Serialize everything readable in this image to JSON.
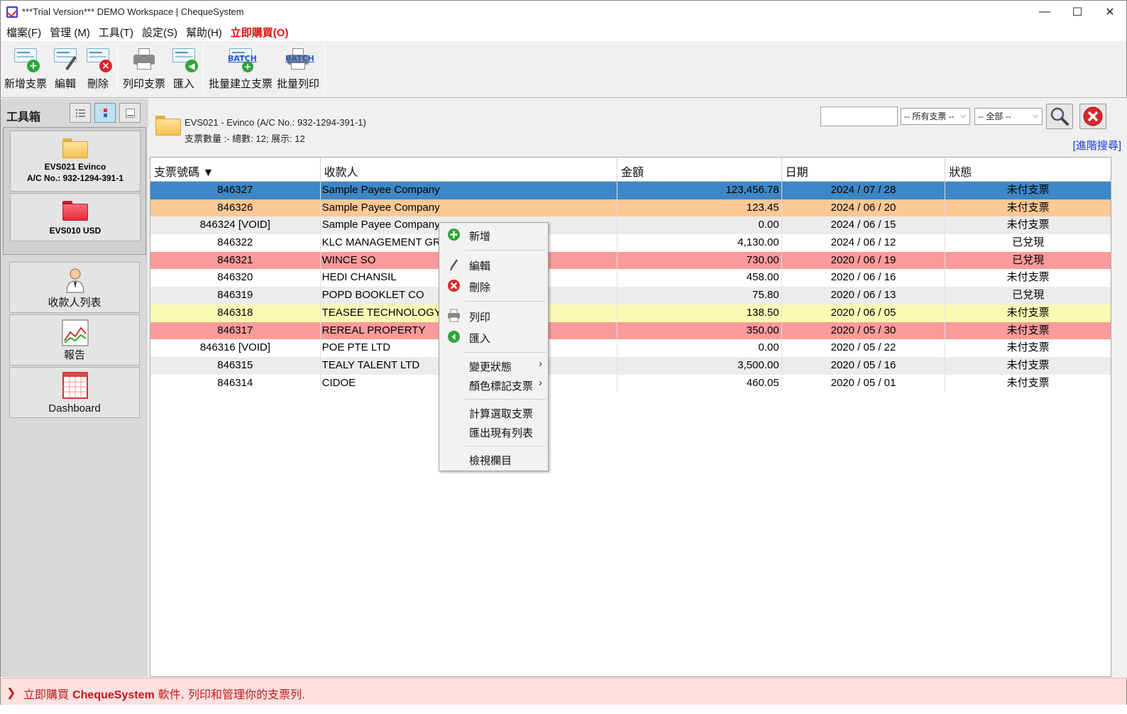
{
  "window": {
    "title": "***Trial Version*** DEMO Workspace | ChequeSystem",
    "minimize": "—",
    "maximize": "☐",
    "close": "✕"
  },
  "menu": [
    "檔案(F)",
    "管理 (M)",
    "工具(T)",
    "設定(S)",
    "幫助(H)",
    "立即購買(O)"
  ],
  "toolbar": {
    "new_cheque": "新增支票",
    "edit": "編輯",
    "delete": "刪除",
    "print_cheque": "列印支票",
    "import": "匯入",
    "batch_create": "批量建立支票",
    "batch_print": "批量列印",
    "batch_badge": "BATCH"
  },
  "sidebar": {
    "title": "工具箱",
    "accounts": [
      {
        "name": "EVS021 Evinco",
        "acno": "A/C No.: 932-1294-391-1"
      },
      {
        "name": "EVS010 USD",
        "acno": ""
      }
    ],
    "nav": [
      "收款人列表",
      "報告",
      "Dashboard"
    ]
  },
  "account_header": {
    "line1": "EVS021 - Evinco (A/C No.: 932-1294-391-1)",
    "line2": "支票數量 :- 總數: 12; 展示: 12"
  },
  "filters": {
    "search_value": "",
    "cheque_filter": "-- 所有支票 --",
    "status_filter": "-- 全部 --",
    "advanced_search": "[進階搜尋]"
  },
  "table": {
    "columns": [
      "支票號碼 ▼",
      "收款人",
      "金額",
      "日期",
      "狀態"
    ],
    "rows": [
      {
        "no": "846327",
        "payee": "Sample Payee Company",
        "amount": "123,456.78",
        "date": "2024 / 07 / 28",
        "status": "未付支票",
        "bg": "#3d87c6"
      },
      {
        "no": "846326",
        "payee": "Sample Payee Company",
        "amount": "123.45",
        "date": "2024 / 06 / 20",
        "status": "未付支票",
        "bg": "#fcc896"
      },
      {
        "no": "846324 [VOID]",
        "payee": "Sample Payee Company",
        "amount": "0.00",
        "date": "2024 / 06 / 15",
        "status": "未付支票",
        "bg": "#ececec"
      },
      {
        "no": "846322",
        "payee": "KLC MANAGEMENT GROUP",
        "amount": "4,130.00",
        "date": "2024 / 06 / 12",
        "status": "已兌現",
        "bg": "#ffffff"
      },
      {
        "no": "846321",
        "payee": "WINCE SO",
        "amount": "730.00",
        "date": "2020 / 06 / 19",
        "status": "已兌現",
        "bg": "#fb9b9b"
      },
      {
        "no": "846320",
        "payee": "HEDI CHANSIL",
        "amount": "458.00",
        "date": "2020 / 06 / 16",
        "status": "未付支票",
        "bg": "#ffffff"
      },
      {
        "no": "846319",
        "payee": "POPD BOOKLET CO",
        "amount": "75.80",
        "date": "2020 / 06 / 13",
        "status": "已兌現",
        "bg": "#ececec"
      },
      {
        "no": "846318",
        "payee": "TEASEE TECHNOLOGY",
        "amount": "138.50",
        "date": "2020 / 06 / 05",
        "status": "未付支票",
        "bg": "#fafab4"
      },
      {
        "no": "846317",
        "payee": "REREAL PROPERTY",
        "amount": "350.00",
        "date": "2020 / 05 / 30",
        "status": "未付支票",
        "bg": "#fb9b9b"
      },
      {
        "no": "846316 [VOID]",
        "payee": "POE PTE LTD",
        "amount": "0.00",
        "date": "2020 / 05 / 22",
        "status": "未付支票",
        "bg": "#ffffff"
      },
      {
        "no": "846315",
        "payee": "TEALY TALENT LTD",
        "amount": "3,500.00",
        "date": "2020 / 05 / 16",
        "status": "未付支票",
        "bg": "#ececec"
      },
      {
        "no": "846314",
        "payee": "CIDOE",
        "amount": "460.05",
        "date": "2020 / 05 / 01",
        "status": "未付支票",
        "bg": "#ffffff"
      }
    ]
  },
  "context_menu": {
    "new": "新增",
    "edit": "編輯",
    "delete": "刪除",
    "print": "列印",
    "import": "匯入",
    "change_status": "變更狀態",
    "color_mark": "顏色標記支票",
    "calc_selected": "計算選取支票",
    "export_list": "匯出現有列表",
    "view_columns": "檢視欄目",
    "submenu_arrow": "›"
  },
  "status_bar": {
    "prefix": "立即購買 ",
    "brand": "ChequeSystem",
    "suffix": " 軟件. 列印和管理你的支票列."
  },
  "colors": {
    "selected_row": "#3d87c6",
    "buy_red": "#e01010",
    "status_red": "#c01818",
    "link_blue": "#1a3cd8"
  }
}
